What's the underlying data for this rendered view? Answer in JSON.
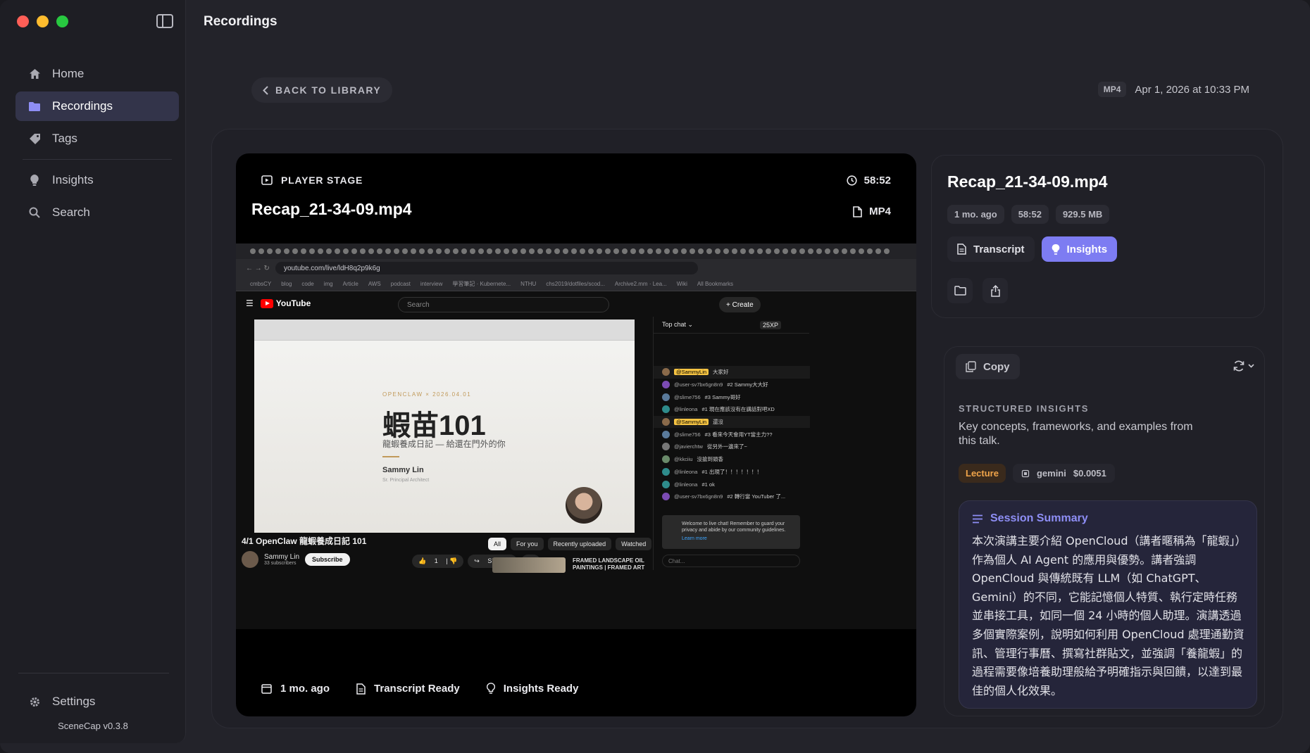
{
  "window": {
    "title": "Recordings"
  },
  "sidebar": {
    "items": [
      {
        "label": "Home",
        "icon": "home-icon"
      },
      {
        "label": "Recordings",
        "icon": "folder-icon",
        "active": true
      },
      {
        "label": "Tags",
        "icon": "tag-icon"
      },
      {
        "label": "Insights",
        "icon": "lightbulb-icon"
      },
      {
        "label": "Search",
        "icon": "search-icon"
      }
    ],
    "settings_label": "Settings",
    "version": "SceneCap v0.3.8"
  },
  "header": {
    "back_label": "BACK TO LIBRARY",
    "format_badge": "MP4",
    "date": "Apr 1, 2026 at 10:33 PM"
  },
  "player": {
    "stage_label": "PLAYER STAGE",
    "duration": "58:52",
    "title": "Recap_21-34-09.mp4",
    "format": "MP4",
    "footer": {
      "age": "1 mo. ago",
      "transcript": "Transcript Ready",
      "insights": "Insights Ready"
    }
  },
  "video_frame": {
    "url": "youtube.com/live/ldH8q2p9k6g",
    "bookmarks": [
      "cmbsCY",
      "blog",
      "code",
      "img",
      "Article",
      "AWS",
      "podcast",
      "interview",
      "學習筆記 · Kubernete...",
      "NTHU",
      "chs2019/dotfiles/scod...",
      "Archive2.mm · Lea...",
      "Wiki",
      "All Bookmarks"
    ],
    "yt_brand": "YouTube",
    "yt_search": "Search",
    "yt_create": "+ Create",
    "slide": {
      "tag": "OPENCLAW × 2026.04.01",
      "heading": "蝦苗101",
      "subheading": "龍蝦養成日記 — 給還在門外的你",
      "presenter": "Sammy Lin",
      "role": "Sr. Principal Architect"
    },
    "chat": {
      "header": "Top chat ⌄",
      "xp": "25XP",
      "messages": [
        {
          "user": "@SammyLin",
          "text": "大家好",
          "hl": true
        },
        {
          "user": "@user-sv7bx6gn8n9",
          "text": "#2 Sammy大大好"
        },
        {
          "user": "@slime756",
          "text": "#3 Sammy哥好"
        },
        {
          "user": "@linleona",
          "text": "#1 現在應該沒有在講話對吧XD"
        },
        {
          "user": "@SammyLin",
          "text": "還沒",
          "hl": true
        },
        {
          "user": "@slime756",
          "text": "#3 看來今天會用YT當主力??"
        },
        {
          "user": "@javierchtw",
          "text": "從另外一邊來了~"
        },
        {
          "user": "@kkciiu",
          "text": "沒搶到頭香"
        },
        {
          "user": "@linleona",
          "text": "#1 出現了！！！！！！！"
        },
        {
          "user": "@linleona",
          "text": "#1 ok"
        },
        {
          "user": "@user-sv7bx6gn8n9",
          "text": "#2 轉行當 YouTuber 了..."
        }
      ],
      "notice": "Welcome to live chat! Remember to guard your privacy and abide by our community guidelines.",
      "notice_link": "Learn more",
      "input_placeholder": "Chat..."
    },
    "video_title": "4/1 OpenClaw 龍蝦養成日記 101",
    "channel": "Sammy Lin",
    "subscribers": "33 subscribers",
    "subscribe": "Subscribe",
    "likes": "1",
    "share": "Share",
    "chips": [
      "All",
      "For you",
      "Recently uploaded",
      "Watched"
    ],
    "related_title": "FRAMED LANDSCAPE OIL PAINTINGS | FRAMED ART"
  },
  "details": {
    "title": "Recap_21-34-09.mp4",
    "chips": [
      "1 mo. ago",
      "58:52",
      "929.5 MB"
    ],
    "tab_transcript": "Transcript",
    "tab_insights": "Insights"
  },
  "insights": {
    "copy_label": "Copy",
    "section_label": "STRUCTURED INSIGHTS",
    "description": "Key concepts, frameworks, and examples from this talk.",
    "category": "Lecture",
    "model": "gemini",
    "cost": "$0.0051",
    "summary_title": "Session Summary",
    "summary_text": "本次演講主要介紹 OpenCloud（講者暱稱為「龍蝦」）作為個人 AI Agent 的應用與優勢。講者強調 OpenCloud 與傳統既有 LLM（如 ChatGPT、Gemini）的不同，它能記憶個人特質、執行定時任務並串接工具，如同一個 24 小時的個人助理。演講透過多個實際案例，說明如何利用 OpenCloud 處理通勤資訊、管理行事曆、撰寫社群貼文，並強調「養龍蝦」的過程需要像培養助理般給予明確指示與回饋，以達到最佳的個人化效果。"
  },
  "colors": {
    "accent": "#7d7cf2",
    "lecture": "#f0a44a",
    "bg": "#23232a"
  }
}
